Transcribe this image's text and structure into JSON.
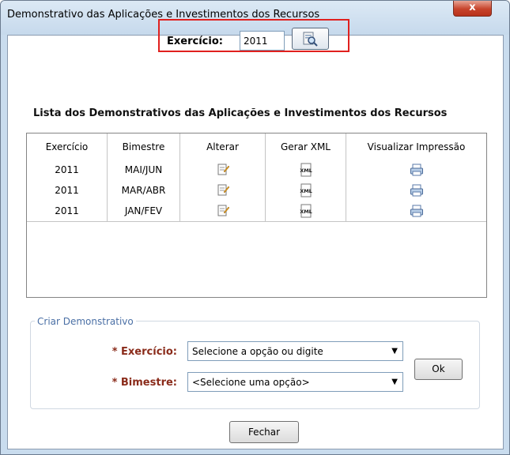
{
  "window": {
    "title": "Demonstrativo das Aplicações e Investimentos dos Recursos",
    "close_label": "x"
  },
  "filter": {
    "label": "Exercício:",
    "value": "2011",
    "search_icon": "search-icon"
  },
  "list": {
    "title": "Lista dos Demonstrativos das Aplicações e Investimentos dos Recursos",
    "columns": [
      "Exercício",
      "Bimestre",
      "Alterar",
      "Gerar XML",
      "Visualizar Impressão"
    ],
    "rows": [
      {
        "exercicio": "2011",
        "bimestre": "MAI/JUN"
      },
      {
        "exercicio": "2011",
        "bimestre": "MAR/ABR"
      },
      {
        "exercicio": "2011",
        "bimestre": "JAN/FEV"
      }
    ],
    "icons": {
      "alterar": "edit-icon",
      "xml": "xml-file-icon",
      "print": "printer-icon"
    },
    "xml_icon_text": "XML"
  },
  "create": {
    "legend": "Criar Demonstrativo",
    "exercicio_label": "* Exercício:",
    "exercicio_value": "Selecione a opção ou digite",
    "bimestre_label": "* Bimestre:",
    "bimestre_value": "<Selecione uma opção>",
    "ok_label": "Ok"
  },
  "footer": {
    "close_label": "Fechar"
  },
  "colors": {
    "highlight_border": "#e0201e",
    "required_label": "#8a2b1a",
    "legend_text": "#4a6fa5"
  }
}
